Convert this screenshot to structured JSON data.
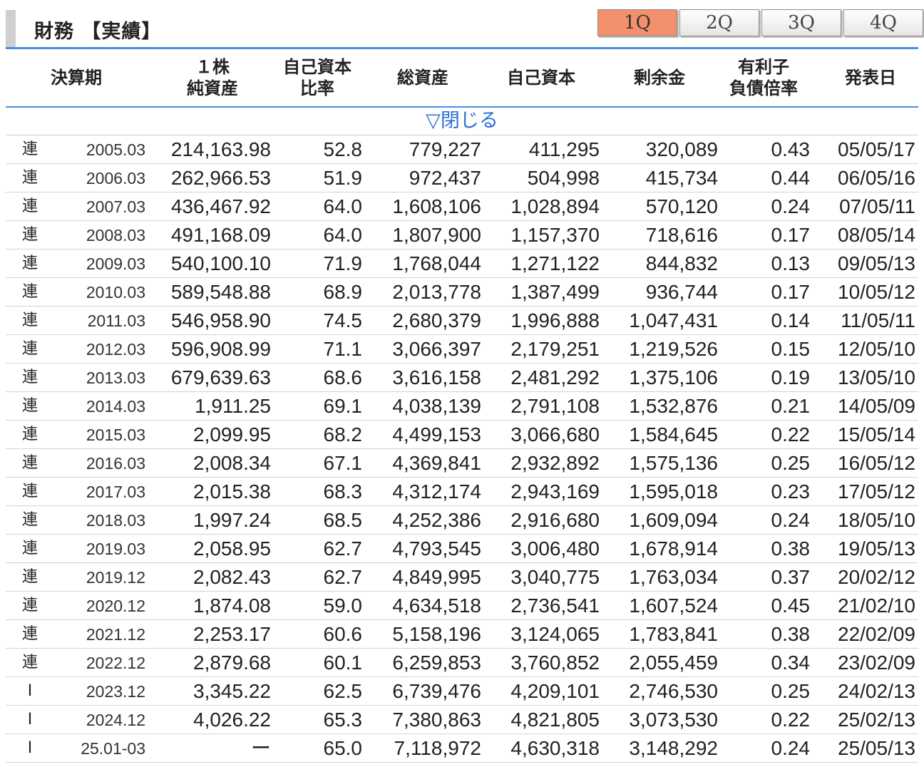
{
  "header": {
    "title": "財務 【実績】"
  },
  "tabs": [
    "1Q",
    "2Q",
    "3Q",
    "4Q"
  ],
  "active_tab": "1Q",
  "columns": {
    "period": "決算期",
    "bps_line1": "１株",
    "bps_line2": "純資産",
    "equity_ratio_line1": "自己資本",
    "equity_ratio_line2": "比率",
    "total_assets": "総資産",
    "equity": "自己資本",
    "retained_earnings": "剰余金",
    "der_line1": "有利子",
    "der_line2": "負債倍率",
    "announce_date": "発表日"
  },
  "toggle_label": "▽閉じる",
  "rows": [
    {
      "type": "連",
      "period": "2005.03",
      "bps": "214,163.98",
      "ratio": "52.8",
      "assets": "779,227",
      "equity": "411,295",
      "surplus": "320,089",
      "der": "0.43",
      "date": "05/05/17"
    },
    {
      "type": "連",
      "period": "2006.03",
      "bps": "262,966.53",
      "ratio": "51.9",
      "assets": "972,437",
      "equity": "504,998",
      "surplus": "415,734",
      "der": "0.44",
      "date": "06/05/16"
    },
    {
      "type": "連",
      "period": "2007.03",
      "bps": "436,467.92",
      "ratio": "64.0",
      "assets": "1,608,106",
      "equity": "1,028,894",
      "surplus": "570,120",
      "der": "0.24",
      "date": "07/05/11"
    },
    {
      "type": "連",
      "period": "2008.03",
      "bps": "491,168.09",
      "ratio": "64.0",
      "assets": "1,807,900",
      "equity": "1,157,370",
      "surplus": "718,616",
      "der": "0.17",
      "date": "08/05/14"
    },
    {
      "type": "連",
      "period": "2009.03",
      "bps": "540,100.10",
      "ratio": "71.9",
      "assets": "1,768,044",
      "equity": "1,271,122",
      "surplus": "844,832",
      "der": "0.13",
      "date": "09/05/13"
    },
    {
      "type": "連",
      "period": "2010.03",
      "bps": "589,548.88",
      "ratio": "68.9",
      "assets": "2,013,778",
      "equity": "1,387,499",
      "surplus": "936,744",
      "der": "0.17",
      "date": "10/05/12"
    },
    {
      "type": "連",
      "period": "2011.03",
      "bps": "546,958.90",
      "ratio": "74.5",
      "assets": "2,680,379",
      "equity": "1,996,888",
      "surplus": "1,047,431",
      "der": "0.14",
      "date": "11/05/11"
    },
    {
      "type": "連",
      "period": "2012.03",
      "bps": "596,908.99",
      "ratio": "71.1",
      "assets": "3,066,397",
      "equity": "2,179,251",
      "surplus": "1,219,526",
      "der": "0.15",
      "date": "12/05/10"
    },
    {
      "type": "連",
      "period": "2013.03",
      "bps": "679,639.63",
      "ratio": "68.6",
      "assets": "3,616,158",
      "equity": "2,481,292",
      "surplus": "1,375,106",
      "der": "0.19",
      "date": "13/05/10"
    },
    {
      "type": "連",
      "period": "2014.03",
      "bps": "1,911.25",
      "ratio": "69.1",
      "assets": "4,038,139",
      "equity": "2,791,108",
      "surplus": "1,532,876",
      "der": "0.21",
      "date": "14/05/09"
    },
    {
      "type": "連",
      "period": "2015.03",
      "bps": "2,099.95",
      "ratio": "68.2",
      "assets": "4,499,153",
      "equity": "3,066,680",
      "surplus": "1,584,645",
      "der": "0.22",
      "date": "15/05/14"
    },
    {
      "type": "連",
      "period": "2016.03",
      "bps": "2,008.34",
      "ratio": "67.1",
      "assets": "4,369,841",
      "equity": "2,932,892",
      "surplus": "1,575,136",
      "der": "0.25",
      "date": "16/05/12"
    },
    {
      "type": "連",
      "period": "2017.03",
      "bps": "2,015.38",
      "ratio": "68.3",
      "assets": "4,312,174",
      "equity": "2,943,169",
      "surplus": "1,595,018",
      "der": "0.23",
      "date": "17/05/12"
    },
    {
      "type": "連",
      "period": "2018.03",
      "bps": "1,997.24",
      "ratio": "68.5",
      "assets": "4,252,386",
      "equity": "2,916,680",
      "surplus": "1,609,094",
      "der": "0.24",
      "date": "18/05/10"
    },
    {
      "type": "連",
      "period": "2019.03",
      "bps": "2,058.95",
      "ratio": "62.7",
      "assets": "4,793,545",
      "equity": "3,006,480",
      "surplus": "1,678,914",
      "der": "0.38",
      "date": "19/05/13"
    },
    {
      "type": "連",
      "period": "2019.12",
      "bps": "2,082.43",
      "ratio": "62.7",
      "assets": "4,849,995",
      "equity": "3,040,775",
      "surplus": "1,763,034",
      "der": "0.37",
      "date": "20/02/12"
    },
    {
      "type": "連",
      "period": "2020.12",
      "bps": "1,874.08",
      "ratio": "59.0",
      "assets": "4,634,518",
      "equity": "2,736,541",
      "surplus": "1,607,524",
      "der": "0.45",
      "date": "21/02/10"
    },
    {
      "type": "連",
      "period": "2021.12",
      "bps": "2,253.17",
      "ratio": "60.6",
      "assets": "5,158,196",
      "equity": "3,124,065",
      "surplus": "1,783,841",
      "der": "0.38",
      "date": "22/02/09"
    },
    {
      "type": "連",
      "period": "2022.12",
      "bps": "2,879.68",
      "ratio": "60.1",
      "assets": "6,259,853",
      "equity": "3,760,852",
      "surplus": "2,055,459",
      "der": "0.34",
      "date": "23/02/09"
    },
    {
      "type": "I",
      "period": "2023.12",
      "bps": "3,345.22",
      "ratio": "62.5",
      "assets": "6,739,476",
      "equity": "4,209,101",
      "surplus": "2,746,530",
      "der": "0.25",
      "date": "24/02/13"
    },
    {
      "type": "I",
      "period": "2024.12",
      "bps": "4,026.22",
      "ratio": "65.3",
      "assets": "7,380,863",
      "equity": "4,821,805",
      "surplus": "3,073,530",
      "der": "0.22",
      "date": "25/02/13"
    },
    {
      "type": "I",
      "period": "25.01-03",
      "bps": "ー",
      "ratio": "65.0",
      "assets": "7,118,972",
      "equity": "4,630,318",
      "surplus": "3,148,292",
      "der": "0.24",
      "date": "25/05/13"
    }
  ]
}
